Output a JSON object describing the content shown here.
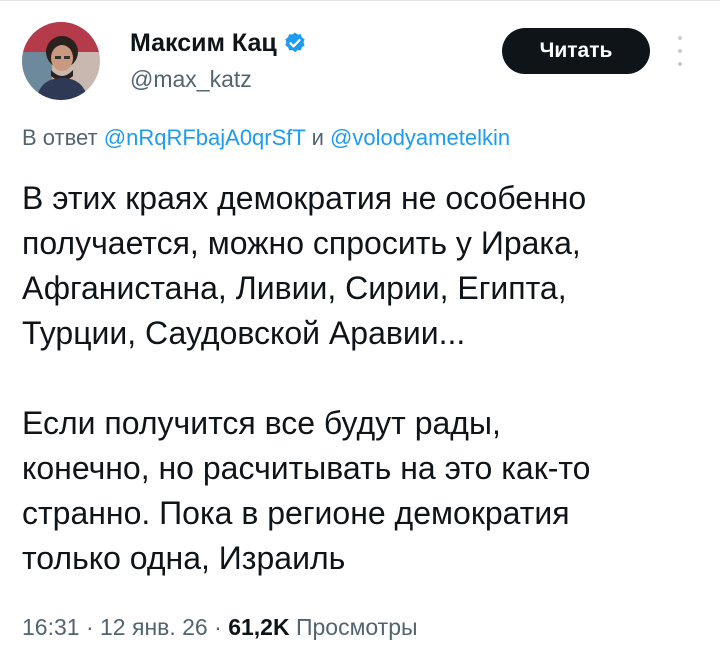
{
  "author": {
    "display_name": "Максим Кац",
    "handle": "@max_katz",
    "verified": true
  },
  "follow_button": {
    "label": "Читать"
  },
  "reply_to": {
    "prefix": "В ответ",
    "user1": "@nRqRFbajA0qrSfT",
    "connector": "и",
    "user2": "@volodyametelkin"
  },
  "tweet": {
    "paragraph1": [
      "В этих краях демократия не особенно",
      "получается, можно спросить у Ирака,",
      "Афганистана, Ливии, Сирии, Египта,",
      "Турции, Саудовской Аравии..."
    ],
    "paragraph2": [
      "Если получится все будут рады,",
      "конечно, но расчитывать на это как-то",
      "странно. Пока в регионе демократия",
      "только одна, Израиль"
    ]
  },
  "meta": {
    "time": "16:31",
    "date": "12 янв. 26",
    "views_count": "61,2K",
    "views_label": "Просмотры"
  },
  "colors": {
    "accent": "#1d9bf0",
    "text": "#0f1419",
    "muted": "#536471",
    "button": "#0f1419"
  }
}
